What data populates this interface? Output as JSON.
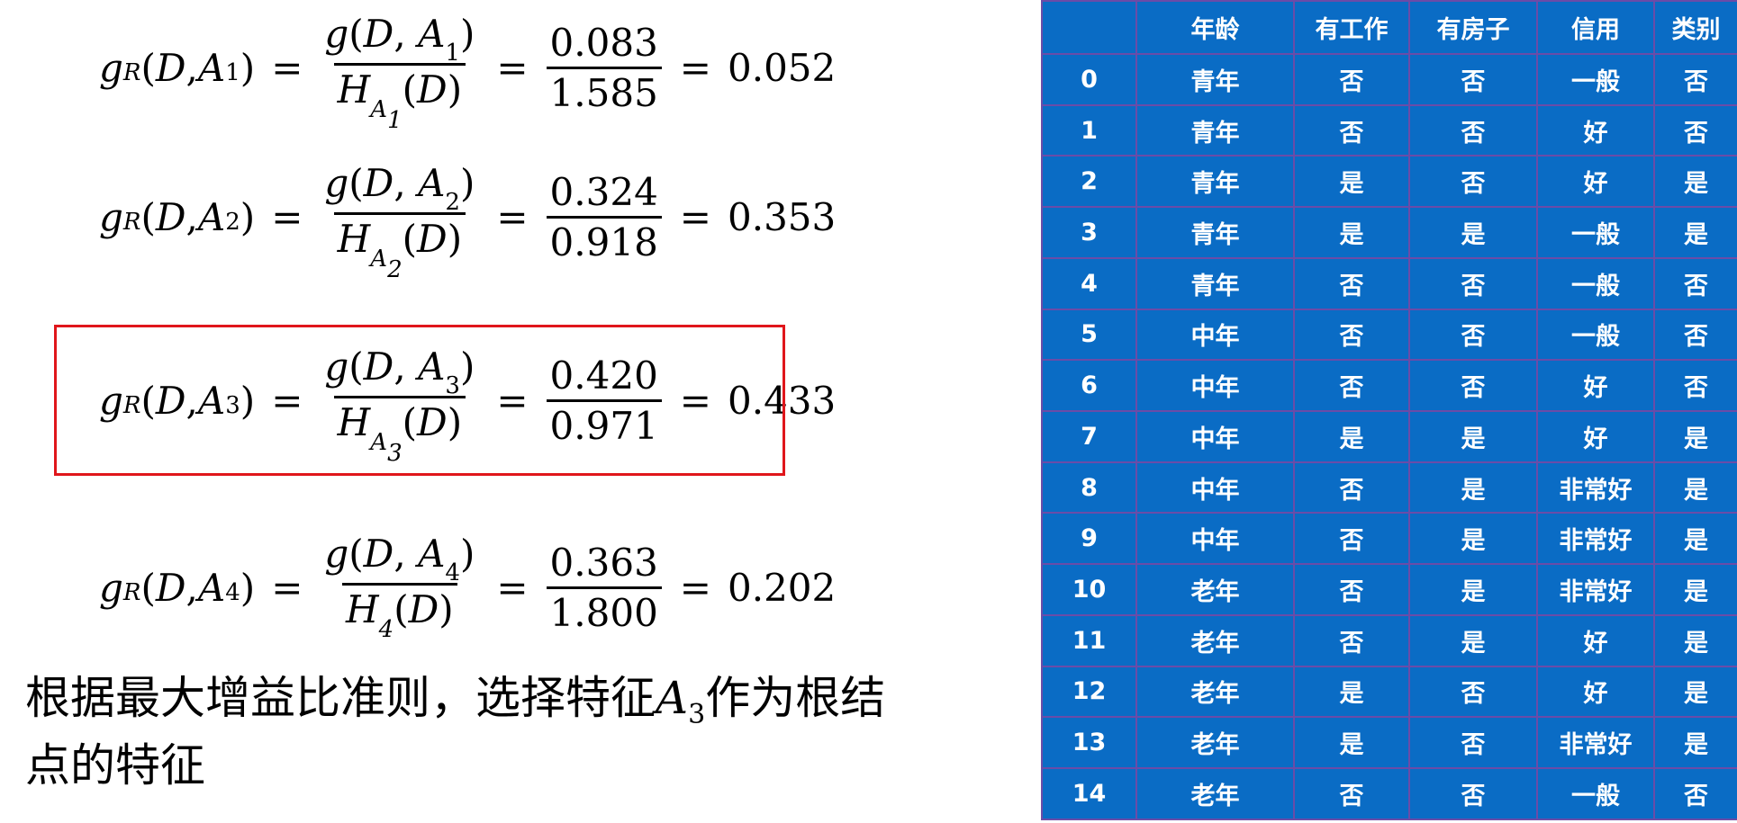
{
  "formulas": [
    {
      "lhs_sub": "R",
      "arg": "D",
      "attr": "A",
      "attr_sub": "1",
      "den_sub": "A",
      "den_sub_sub": "1",
      "num_val": "0.083",
      "den_val": "1.585",
      "result": "0.052"
    },
    {
      "lhs_sub": "R",
      "arg": "D",
      "attr": "A",
      "attr_sub": "2",
      "den_sub": "A",
      "den_sub_sub": "2",
      "num_val": "0.324",
      "den_val": "0.918",
      "result": "0.353"
    },
    {
      "lhs_sub": "R",
      "arg": "D",
      "attr": "A",
      "attr_sub": "3",
      "den_sub": "A",
      "den_sub_sub": "3",
      "num_val": "0.420",
      "den_val": "0.971",
      "result": "0.433"
    },
    {
      "lhs_sub": "R",
      "arg": "D",
      "attr": "A",
      "attr_sub": "4",
      "den_sub": "4",
      "den_sub_sub": "",
      "num_val": "0.363",
      "den_val": "1.800",
      "result": "0.202"
    }
  ],
  "conclusion": {
    "before": "根据最大增益比准则，选择特征",
    "var": "A",
    "var_sub": "3",
    "after": "作为根结点的特征"
  },
  "table": {
    "headers": [
      "",
      "年龄",
      "有工作",
      "有房子",
      "信用",
      "类别"
    ],
    "rows": [
      [
        "0",
        "青年",
        "否",
        "否",
        "一般",
        "否"
      ],
      [
        "1",
        "青年",
        "否",
        "否",
        "好",
        "否"
      ],
      [
        "2",
        "青年",
        "是",
        "否",
        "好",
        "是"
      ],
      [
        "3",
        "青年",
        "是",
        "是",
        "一般",
        "是"
      ],
      [
        "4",
        "青年",
        "否",
        "否",
        "一般",
        "否"
      ],
      [
        "5",
        "中年",
        "否",
        "否",
        "一般",
        "否"
      ],
      [
        "6",
        "中年",
        "否",
        "否",
        "好",
        "否"
      ],
      [
        "7",
        "中年",
        "是",
        "是",
        "好",
        "是"
      ],
      [
        "8",
        "中年",
        "否",
        "是",
        "非常好",
        "是"
      ],
      [
        "9",
        "中年",
        "否",
        "是",
        "非常好",
        "是"
      ],
      [
        "10",
        "老年",
        "否",
        "是",
        "非常好",
        "是"
      ],
      [
        "11",
        "老年",
        "否",
        "是",
        "好",
        "是"
      ],
      [
        "12",
        "老年",
        "是",
        "否",
        "好",
        "是"
      ],
      [
        "13",
        "老年",
        "是",
        "否",
        "非常好",
        "是"
      ],
      [
        "14",
        "老年",
        "否",
        "否",
        "一般",
        "否"
      ]
    ]
  },
  "colors": {
    "table_bg": "#0a6cc5",
    "table_border": "#6b4ca8",
    "highlight": "#e0161b"
  }
}
